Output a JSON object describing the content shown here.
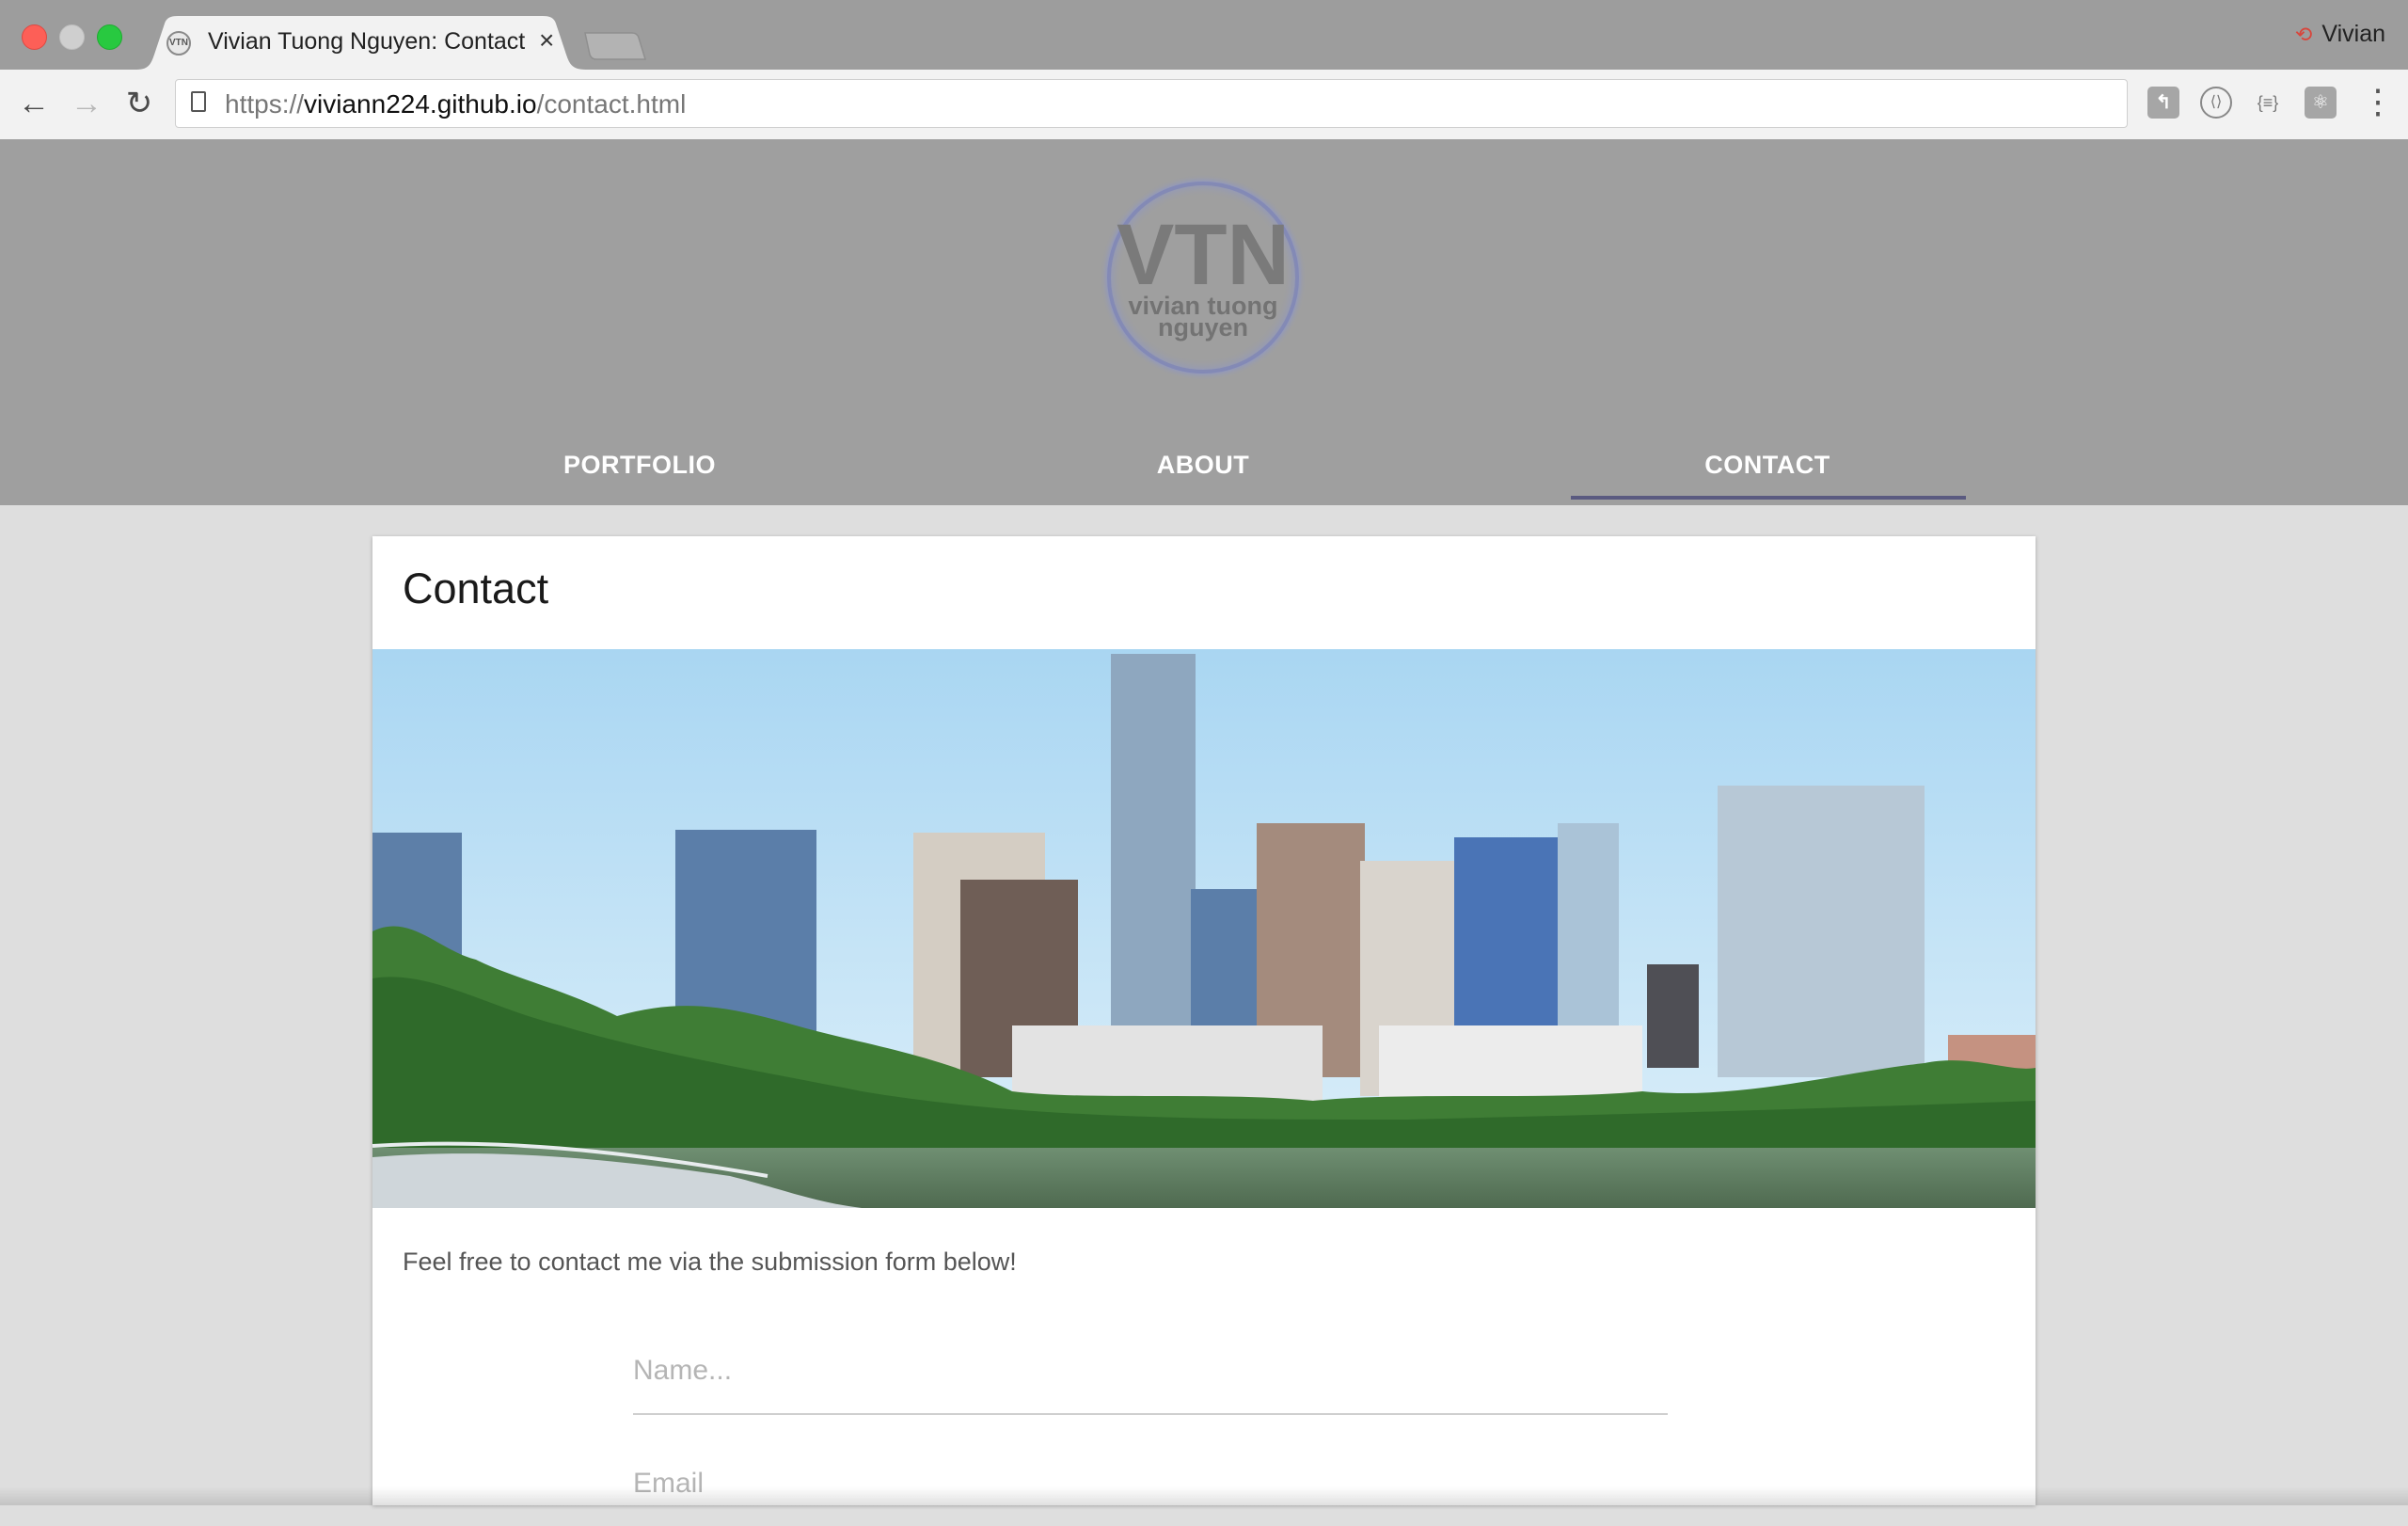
{
  "browser": {
    "tab_title": "Vivian Tuong Nguyen: Contact",
    "tab_close": "×",
    "favicon_text": "VTN",
    "profile_name": "Vivian",
    "url_scheme": "https://",
    "url_host": "viviann224.github.io",
    "url_path": "/contact.html",
    "back_glyph": "←",
    "forward_glyph": "→",
    "reload_glyph": "↻",
    "menu_glyph": "⋮"
  },
  "header": {
    "logo_text_big": "VTN",
    "logo_text_line1": "vivian tuong",
    "logo_text_line2": "nguyen",
    "nav": [
      {
        "label": "PORTFOLIO"
      },
      {
        "label": "ABOUT"
      },
      {
        "label": "CONTACT",
        "active": true
      }
    ]
  },
  "main": {
    "title": "Contact",
    "intro": "Feel free to contact me via the submission form below!",
    "name_placeholder": "Name...",
    "email_placeholder": "Email"
  },
  "colors": {
    "tabbar": "#9d9d9d",
    "header_bg": "#9f9f9f",
    "nav_underline": "#5a5a80",
    "page_bg": "#dedede"
  }
}
